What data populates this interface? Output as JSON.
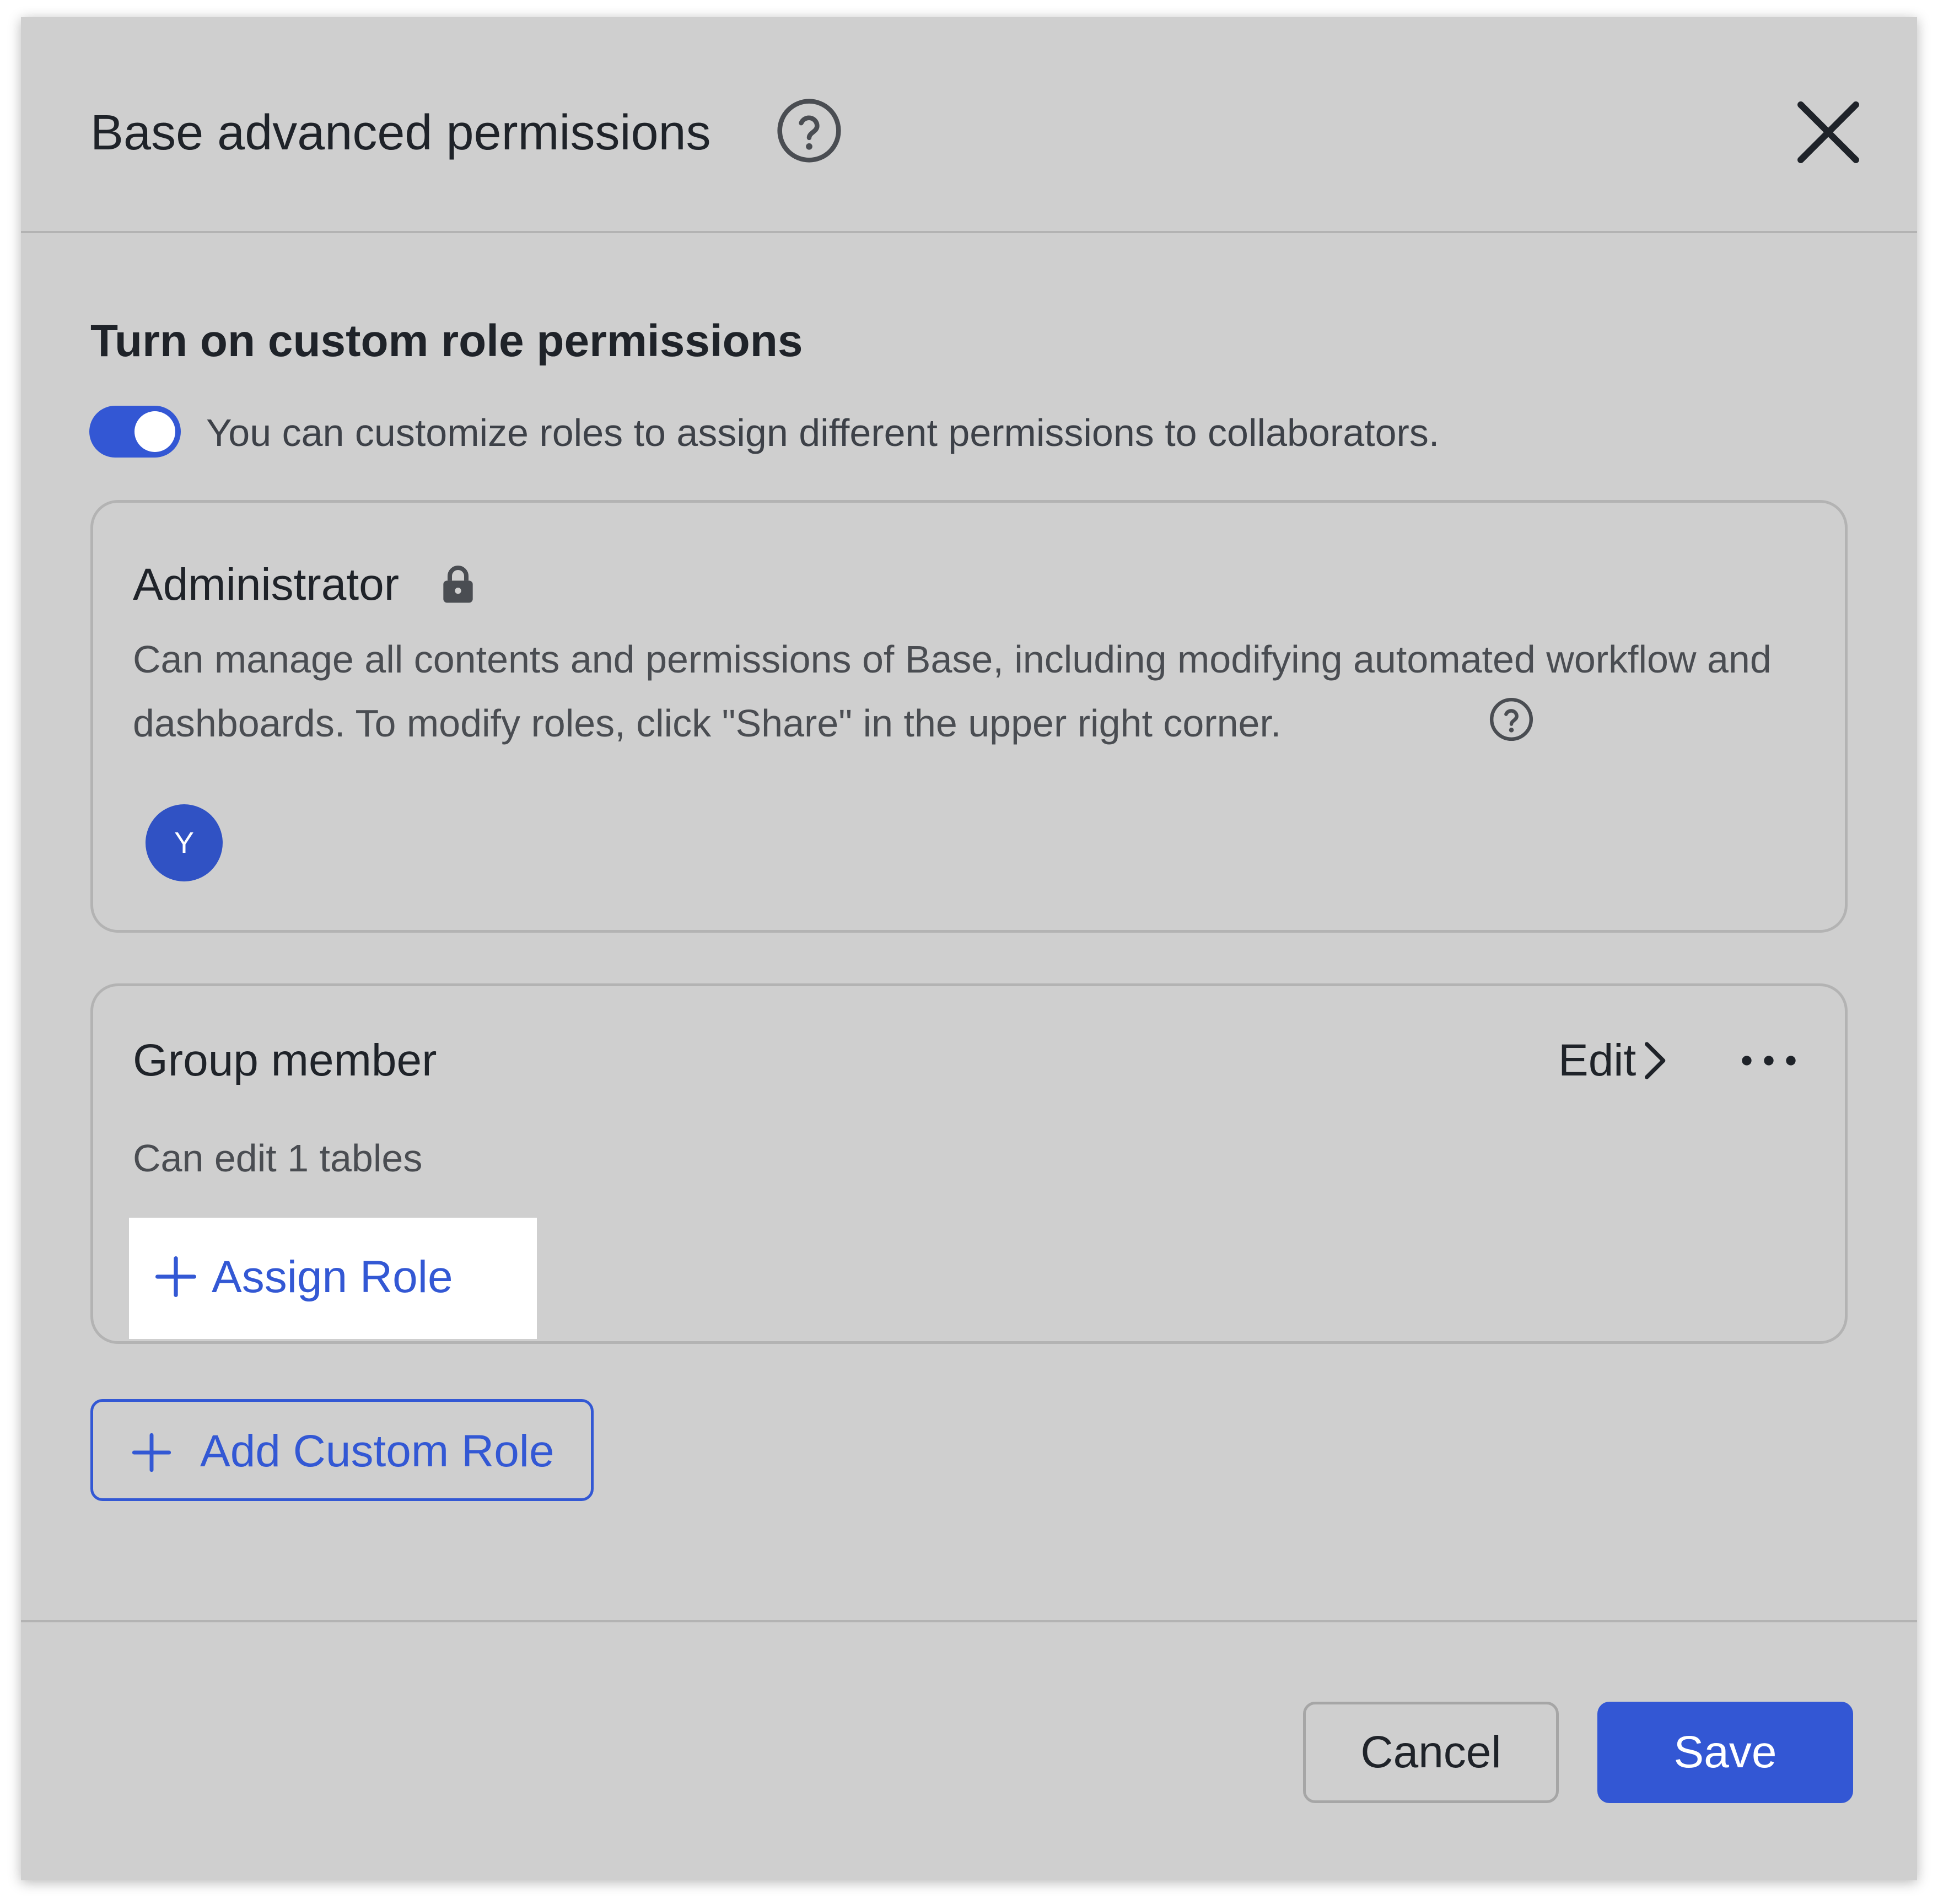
{
  "dialog": {
    "title": "Base advanced permissions",
    "close_icon": "close-icon",
    "help_icon": "question-circle-icon"
  },
  "custom_roles": {
    "section_title": "Turn on custom role permissions",
    "toggle_on": true,
    "toggle_description": "You can customize roles to assign different permissions to collaborators."
  },
  "roles": {
    "administrator": {
      "name": "Administrator",
      "icon": "lock-icon",
      "description": "Can manage all contents and permissions of Base, including modifying automated workflow and dashboards. To modify roles, click \"Share\" in the upper right corner.",
      "member_initial": "Y"
    },
    "group_member": {
      "name": "Group member",
      "edit_label": "Edit",
      "description": "Can edit 1 tables",
      "assign_label": "Assign Role"
    }
  },
  "add_custom_role_label": "Add Custom Role",
  "footer": {
    "cancel_label": "Cancel",
    "save_label": "Save"
  },
  "colors": {
    "accent": "#3357d4",
    "dialog_background": "#cfcfcf",
    "avatar": "#3052c4"
  }
}
